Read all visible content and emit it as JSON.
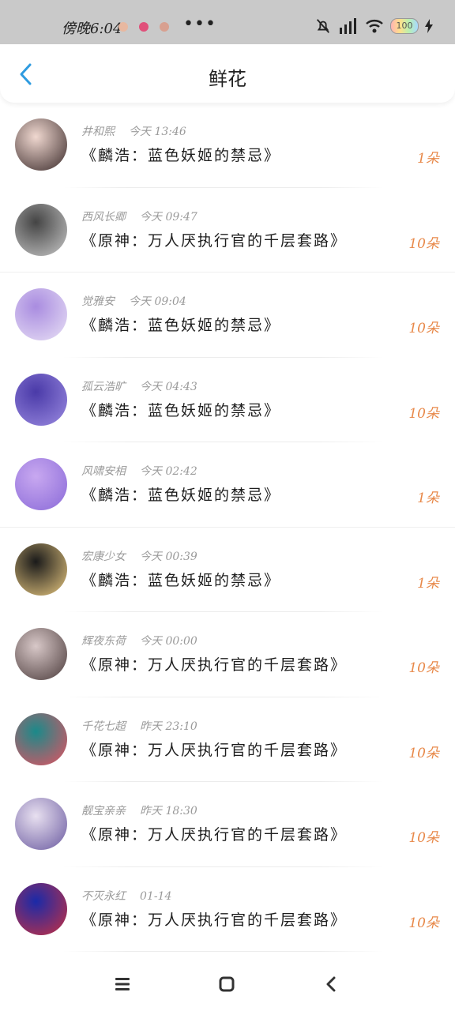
{
  "status_bar": {
    "time": "傍晚6:04",
    "more": "•••",
    "battery_level": "100",
    "notification_colors": [
      "#e8b8a0",
      "#e0507a",
      "#d8a090"
    ]
  },
  "header": {
    "title": "鲜花",
    "back_icon": "chevron-left-icon",
    "accent_color": "#2e9be0"
  },
  "gifts": [
    {
      "user": "井和熙",
      "time": "今天 13:46",
      "book": "《麟浩：蓝色妖姬的禁忌》",
      "amount": "1朵",
      "avatar_colors": [
        "#f0d8d0",
        "#3a2a2a"
      ]
    },
    {
      "user": "西风长卿",
      "time": "今天 09:47",
      "book": "《原神：万人厌执行官的千层套路》",
      "amount": "10朵",
      "avatar_colors": [
        "#444444",
        "#c8c8c8"
      ]
    },
    {
      "user": "觉雅安",
      "time": "今天 09:04",
      "book": "《麟浩：蓝色妖姬的禁忌》",
      "amount": "10朵",
      "avatar_colors": [
        "#a98ce0",
        "#e8e0f5"
      ]
    },
    {
      "user": "孤云浩旷",
      "time": "今天 04:43",
      "book": "《麟浩：蓝色妖姬的禁忌》",
      "amount": "10朵",
      "avatar_colors": [
        "#4a3aa8",
        "#9a8ae0"
      ]
    },
    {
      "user": "风啸安相",
      "time": "今天 02:42",
      "book": "《麟浩：蓝色妖姬的禁忌》",
      "amount": "1朵",
      "avatar_colors": [
        "#c8a8f0",
        "#8a6ad8"
      ]
    },
    {
      "user": "宏康少女",
      "time": "今天 00:39",
      "book": "《麟浩：蓝色妖姬的禁忌》",
      "amount": "1朵",
      "avatar_colors": [
        "#1a1a1a",
        "#e8c880"
      ]
    },
    {
      "user": "辉夜东荷",
      "time": "今天 00:00",
      "book": "《原神：万人厌执行官的千层套路》",
      "amount": "10朵",
      "avatar_colors": [
        "#d8c8c8",
        "#4a3a3a"
      ]
    },
    {
      "user": "千花七超",
      "time": "昨天 23:10",
      "book": "《原神：万人厌执行官的千层套路》",
      "amount": "10朵",
      "avatar_colors": [
        "#1a8a8a",
        "#e85060"
      ]
    },
    {
      "user": "靓宝亲亲",
      "time": "昨天 18:30",
      "book": "《原神：万人厌执行官的千层套路》",
      "amount": "10朵",
      "avatar_colors": [
        "#e8e0f0",
        "#6a5aa0"
      ]
    },
    {
      "user": "不灭永红",
      "time": "01-14",
      "book": "《原神：万人厌执行官的千层套路》",
      "amount": "10朵",
      "avatar_colors": [
        "#1a2aa8",
        "#c83040"
      ]
    }
  ],
  "nav_bar": {
    "menu_icon": "menu-icon",
    "home_icon": "home-square-icon",
    "back_icon": "back-triangle-icon"
  },
  "amount_color": "#e8894a"
}
